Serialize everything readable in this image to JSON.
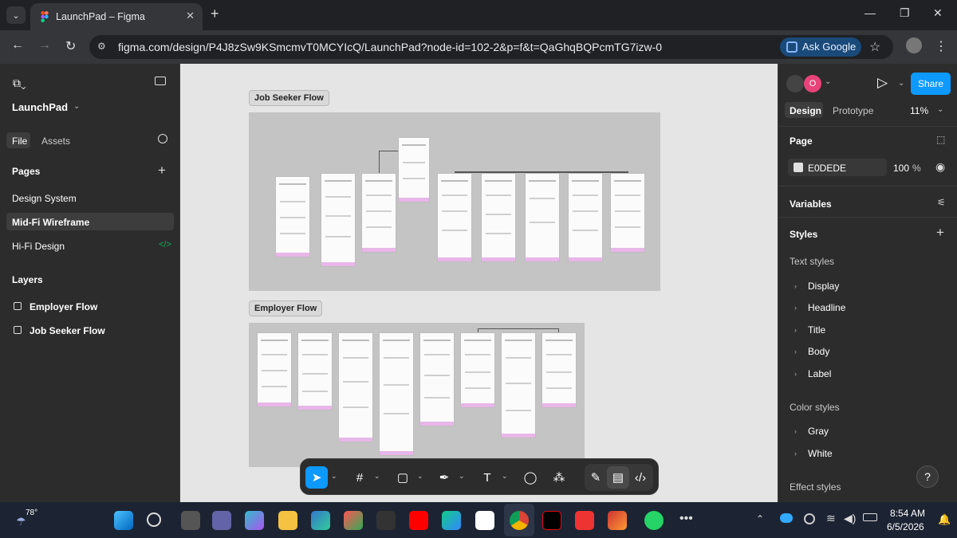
{
  "browser": {
    "tab_title": "LaunchPad – Figma",
    "url": "figma.com/design/P4J8zSw9KSmcmvT0MCYIcQ/LaunchPad?node-id=102-2&p=f&t=QaGhqBQPcmTG7izw-0",
    "ask_google_label": "Ask Google"
  },
  "left_panel": {
    "project_name": "LaunchPad",
    "tabs": [
      "File",
      "Assets"
    ],
    "pages_heading": "Pages",
    "pages": [
      "Design System",
      "Mid-Fi Wireframe",
      "Hi-Fi Design"
    ],
    "selected_page": "Mid-Fi Wireframe",
    "layers_heading": "Layers",
    "layers": [
      "Employer Flow",
      "Job Seeker Flow"
    ]
  },
  "canvas": {
    "sections": [
      {
        "label": "Job Seeker Flow"
      },
      {
        "label": "Employer Flow"
      }
    ]
  },
  "right_panel": {
    "avatar_initial": "O",
    "share_label": "Share",
    "tabs": [
      "Design",
      "Prototype"
    ],
    "zoom": "11%",
    "page_heading": "Page",
    "page_color_hex": "E0DEDE",
    "page_opacity": "100",
    "page_opacity_unit": "%",
    "variables_heading": "Variables",
    "styles_heading": "Styles",
    "text_styles_heading": "Text styles",
    "text_styles": [
      "Display",
      "Headline",
      "Title",
      "Body",
      "Label"
    ],
    "color_styles_heading": "Color styles",
    "color_styles": [
      "Gray",
      "White"
    ],
    "effect_styles_heading": "Effect styles",
    "help_label": "?"
  },
  "taskbar": {
    "weather_temp": "78°",
    "time": "8:54 AM",
    "date": "6/5/2026"
  },
  "colors": {
    "accent": "#0d99ff",
    "canvas_bg": "#e5e5e5",
    "section_bg": "#c4c4c4",
    "panel_bg": "#2c2c2c",
    "page_swatch": "#e0dede"
  }
}
